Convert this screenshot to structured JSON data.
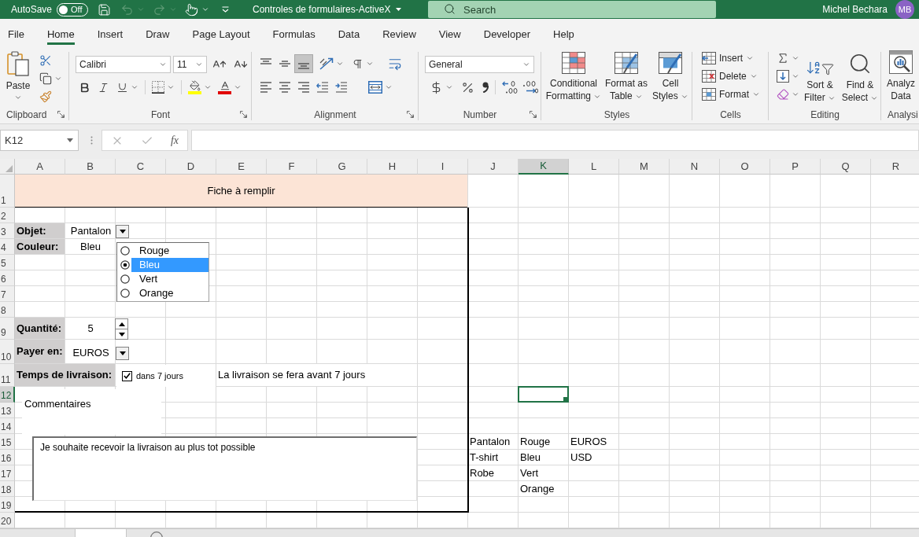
{
  "title_bar": {
    "autosave_label": "AutoSave",
    "autosave_toggle": {
      "text": "Off",
      "on": false
    },
    "undo": {
      "disabled": true
    },
    "redo": {
      "disabled": true
    },
    "document_title": "Controles de formulaires-ActiveX",
    "search": {
      "placeholder": "Search"
    },
    "user_name": "Michel Bechara",
    "avatar_initials": "MB"
  },
  "ribbon_tabs": [
    {
      "label": "File",
      "selected": false
    },
    {
      "label": "Home",
      "selected": true
    },
    {
      "label": "Insert",
      "selected": false
    },
    {
      "label": "Draw",
      "selected": false
    },
    {
      "label": "Page Layout",
      "selected": false
    },
    {
      "label": "Formulas",
      "selected": false
    },
    {
      "label": "Data",
      "selected": false
    },
    {
      "label": "Review",
      "selected": false
    },
    {
      "label": "View",
      "selected": false
    },
    {
      "label": "Developer",
      "selected": false
    },
    {
      "label": "Help",
      "selected": false
    }
  ],
  "ribbon": {
    "groups": [
      {
        "kind": "clipboard",
        "title": "Clipboard",
        "paste_label": "Paste"
      },
      {
        "kind": "font",
        "title": "Font",
        "font_name": "Calibri",
        "font_size": "11"
      },
      {
        "kind": "alignment",
        "title": "Alignment",
        "vertical_buttons": [
          {
            "selected": false
          },
          {
            "selected": false
          },
          {
            "selected": true
          }
        ]
      },
      {
        "kind": "number",
        "title": "Number",
        "format": "General"
      },
      {
        "kind": "styles",
        "title": "Styles",
        "buttons": [
          "Conditional Formatting",
          "Format as Table",
          "Cell Styles"
        ]
      },
      {
        "kind": "cells",
        "title": "Cells",
        "buttons": [
          "Insert",
          "Delete",
          "Format"
        ]
      },
      {
        "kind": "editing",
        "title": "Editing",
        "buttons": [
          "Sort & Filter",
          "Find & Select"
        ]
      },
      {
        "kind": "analysis",
        "title": "Analysi",
        "buttons": [
          "Analyz Data"
        ]
      }
    ]
  },
  "formula_bar": {
    "name_box": "K12",
    "function_label": "fx"
  },
  "sheet": {
    "columns": [
      {
        "label": "A",
        "selected": false
      },
      {
        "label": "B",
        "selected": false
      },
      {
        "label": "C",
        "selected": false
      },
      {
        "label": "D",
        "selected": false
      },
      {
        "label": "E",
        "selected": false
      },
      {
        "label": "F",
        "selected": false
      },
      {
        "label": "G",
        "selected": false
      },
      {
        "label": "H",
        "selected": false
      },
      {
        "label": "I",
        "selected": false
      },
      {
        "label": "J",
        "selected": false
      },
      {
        "label": "K",
        "selected": true
      },
      {
        "label": "L",
        "selected": false
      },
      {
        "label": "M",
        "selected": false
      },
      {
        "label": "N",
        "selected": false
      },
      {
        "label": "O",
        "selected": false
      },
      {
        "label": "P",
        "selected": false
      },
      {
        "label": "Q",
        "selected": false
      },
      {
        "label": "R",
        "selected": false
      }
    ],
    "rows": [
      {
        "label": "1",
        "selected": false
      },
      {
        "label": "2",
        "selected": false
      },
      {
        "label": "3",
        "selected": false
      },
      {
        "label": "4",
        "selected": false
      },
      {
        "label": "5",
        "selected": false
      },
      {
        "label": "6",
        "selected": false
      },
      {
        "label": "7",
        "selected": false
      },
      {
        "label": "8",
        "selected": false
      },
      {
        "label": "9",
        "selected": false
      },
      {
        "label": "10",
        "selected": false
      },
      {
        "label": "11",
        "selected": false
      },
      {
        "label": "12",
        "selected": true
      },
      {
        "label": "13",
        "selected": false
      },
      {
        "label": "14",
        "selected": false
      },
      {
        "label": "15",
        "selected": false
      },
      {
        "label": "16",
        "selected": false
      },
      {
        "label": "17",
        "selected": false
      },
      {
        "label": "18",
        "selected": false
      },
      {
        "label": "19",
        "selected": false
      },
      {
        "label": "20",
        "selected": false
      }
    ],
    "form": {
      "title": "Fiche à remplir",
      "fields": [
        {
          "kind": "combo",
          "label": "Objet:",
          "value": "Pantalon"
        },
        {
          "kind": "text",
          "label": "Couleur:",
          "value": "Bleu"
        },
        {
          "kind": "spin",
          "label": "Quantité:",
          "value": "5"
        },
        {
          "kind": "combo",
          "label": "Payer en:",
          "value": "EUROS"
        },
        {
          "kind": "checkbox",
          "label": "Temps de livraison:",
          "caption": "dans 7 jours",
          "checked": true,
          "message": "La livraison se fera avant 7 jours"
        }
      ],
      "color_options": [
        {
          "label": "Rouge",
          "selected": false
        },
        {
          "label": "Bleu",
          "selected": true
        },
        {
          "label": "Vert",
          "selected": false
        },
        {
          "label": "Orange",
          "selected": false
        }
      ],
      "comments": {
        "label": "Commentaires",
        "value": "Je souhaite recevoir la livraison au plus tot possible"
      }
    },
    "lists": [
      [
        "Pantalon",
        "T-shirt",
        "Robe"
      ],
      [
        "Rouge",
        "Bleu",
        "Vert",
        "Orange"
      ],
      [
        "EUROS",
        "USD"
      ]
    ]
  }
}
